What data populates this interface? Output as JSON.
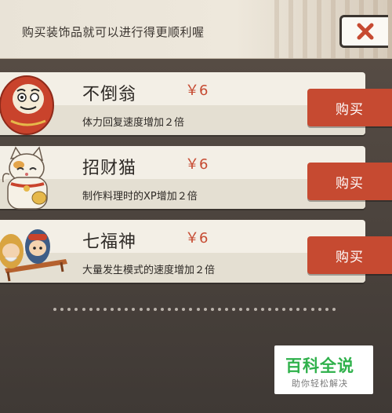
{
  "banner": {
    "text": "购买装饰品就可以进行得更顺利喔",
    "close_icon": "close-x-icon"
  },
  "items": [
    {
      "name": "不倒翁",
      "price": "￥6",
      "desc": "体力回复速度增加２倍",
      "buy_label": "购买",
      "icon": "daruma-icon"
    },
    {
      "name": "招财猫",
      "price": "￥6",
      "desc": "制作料理时的XP增加２倍",
      "buy_label": "购买",
      "icon": "lucky-cat-icon"
    },
    {
      "name": "七福神",
      "price": "￥6",
      "desc": "大量发生模式的速度增加２倍",
      "buy_label": "购买",
      "icon": "seven-gods-icon"
    }
  ],
  "watermark": {
    "title": "百科全说",
    "subtitle": "助你轻松解决"
  },
  "colors": {
    "accent": "#c64a31",
    "watermark_green": "#2fb14b"
  }
}
